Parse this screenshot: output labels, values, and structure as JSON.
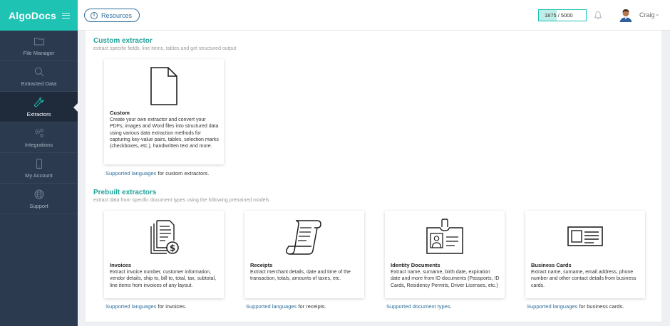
{
  "app": {
    "logo_text": "AlgoDocs",
    "brand_color": "#1ec3b4",
    "sidebar_color": "#2b3a4f"
  },
  "topbar": {
    "resources_label": "Resources",
    "quota_text": "1875 / 5000",
    "quota_used_fraction": 0.375,
    "user_name": "Craig"
  },
  "sidebar": {
    "items": [
      {
        "label": "File Manager",
        "icon": "folder-icon",
        "active": false
      },
      {
        "label": "Extracted Data",
        "icon": "search-icon",
        "active": false
      },
      {
        "label": "Extractors",
        "icon": "wrench-icon",
        "active": true
      },
      {
        "label": "Integrations",
        "icon": "gears-icon",
        "active": false
      },
      {
        "label": "My Account",
        "icon": "phone-icon",
        "active": false
      },
      {
        "label": "Support",
        "icon": "globe-icon",
        "active": false
      }
    ]
  },
  "custom_section": {
    "title": "Custom extractor",
    "subtitle": "extract specific fields, line items, tables and get structured output",
    "card": {
      "title": "Custom",
      "icon": "blank-document-icon",
      "description": "Create your own extractor and convert your PDFs, images and Word files into structured data using various data extraction methods for capturing key-value pairs, tables, selection marks (checkboxes, etc.), handwritten text and more."
    },
    "support": {
      "link": "Supported languages",
      "rest": " for custom extractors."
    }
  },
  "prebuilt_section": {
    "title": "Prebuilt extractors",
    "subtitle": "extract data from specific document types using the following pretrained models",
    "cards": [
      {
        "title": "Invoices",
        "icon": "invoice-icon",
        "description": "Extract invoice number, customer information, vendor details, ship to, bill to, total, tax, subtotal, line items from invoices of any layout.",
        "support_link": "Supported languages",
        "support_rest": " for invoices."
      },
      {
        "title": "Receipts",
        "icon": "receipt-icon",
        "description": "Extract merchant details, date and time of the transaction, totals, amounts of taxes, etc.",
        "support_link": "Supported languages",
        "support_rest": " for receipts."
      },
      {
        "title": "Identity Documents",
        "icon": "id-badge-icon",
        "description": "Extract name, surname, birth date, expiration date and more from ID documents (Passports, ID Cards, Residency Permits, Driver Licenses, etc.)",
        "support_link": "Supported document types",
        "support_rest": "."
      },
      {
        "title": "Business Cards",
        "icon": "business-card-icon",
        "description": "Extract name, surname, email address, phone number and other contact details from business cards.",
        "support_link": "Supported languages",
        "support_rest": " for business cards."
      }
    ]
  }
}
